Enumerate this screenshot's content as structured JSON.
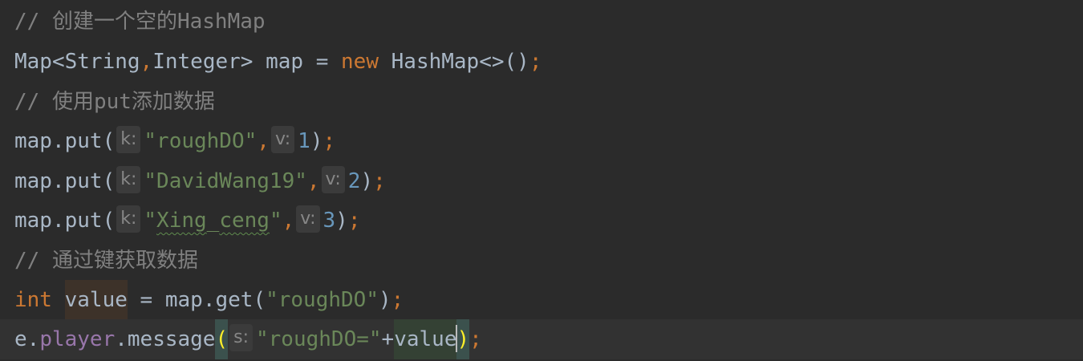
{
  "editor": {
    "line1": {
      "comment": "// 创建一个空的HashMap"
    },
    "line2": {
      "type": "Map<String",
      "comma": ",",
      "type2": "Integer> map = ",
      "kw_new": "new",
      "rest": " HashMap<>()",
      "semi": ";"
    },
    "line3": {
      "comment": "// 使用put添加数据"
    },
    "line4": {
      "call": "map.put(",
      "hint_k": "k:",
      "str": "\"roughDO\"",
      "comma": ",",
      "hint_v": "v:",
      "num": "1",
      "close": ")",
      "semi": ";"
    },
    "line5": {
      "call": "map.put(",
      "hint_k": "k:",
      "str": "\"DavidWang19\"",
      "comma": ",",
      "hint_v": "v:",
      "num": "2",
      "close": ")",
      "semi": ";"
    },
    "line6": {
      "call": "map.put(",
      "hint_k": "k:",
      "str_open": "\"",
      "str_word1": "Xing",
      "str_underscore": "_",
      "str_word2": "ceng",
      "str_close": "\"",
      "comma": ",",
      "hint_v": "v:",
      "num": "3",
      "close": ")",
      "semi": ";"
    },
    "line7": {
      "comment": "// 通过键获取数据"
    },
    "line8": {
      "kw_int": "int",
      "space": " ",
      "var": "value",
      "assign": " = map.get(",
      "str": "\"roughDO\"",
      "close": ")",
      "semi": ";"
    },
    "line9": {
      "obj": "e.",
      "field": "player",
      "method": ".message",
      "open": "(",
      "hint_s": "s:",
      "str": "\"roughDO=\"",
      "plus": "+",
      "var": "value",
      "close": ")",
      "semi": ";"
    }
  },
  "colors": {
    "background": "#2b2b2b",
    "comment": "#808080",
    "keyword": "#cc7832",
    "string": "#6a8759",
    "number": "#6897bb",
    "field": "#9876aa",
    "text": "#a9b7c6",
    "brace_match": "#ffef28"
  }
}
